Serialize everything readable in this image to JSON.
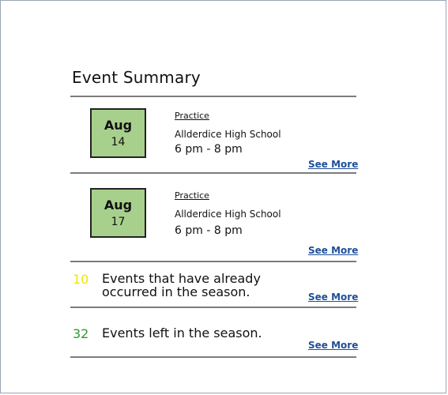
{
  "title": "Event Summary",
  "events": [
    {
      "month": "Aug",
      "day": "14",
      "type": "Practice",
      "location": "Allderdice High School",
      "time": "6 pm - 8 pm",
      "link": "See More"
    },
    {
      "month": "Aug",
      "day": "17",
      "type": "Practice",
      "location": "Allderdice High School",
      "time": "6 pm - 8 pm",
      "link": "See More"
    }
  ],
  "stats": [
    {
      "count": "10",
      "text": "Events that have already occurred in the season.",
      "link": "See More",
      "color": "#f2e600"
    },
    {
      "count": "32",
      "text": "Events left in the season.",
      "link": "See More",
      "color": "#2e9a2e"
    }
  ]
}
